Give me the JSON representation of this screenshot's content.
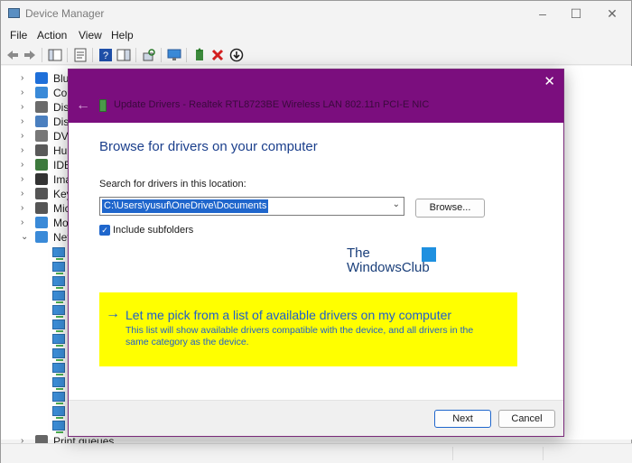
{
  "window": {
    "title": "Device Manager"
  },
  "menu": [
    "File",
    "Action",
    "View",
    "Help"
  ],
  "tree": {
    "items": [
      {
        "label": "Blue",
        "icon": "bluetooth-icon",
        "color": "#1e6fd9"
      },
      {
        "label": "Com",
        "icon": "computer-icon",
        "color": "#3a8ad8"
      },
      {
        "label": "Disk",
        "icon": "disk-drive-icon",
        "color": "#6b6b6b"
      },
      {
        "label": "Disp",
        "icon": "display-adapter-icon",
        "color": "#4a7fbf"
      },
      {
        "label": "DVD",
        "icon": "dvd-drive-icon",
        "color": "#777777"
      },
      {
        "label": "Hum",
        "icon": "hid-icon",
        "color": "#5a5a5a"
      },
      {
        "label": "IDE",
        "icon": "ide-controller-icon",
        "color": "#3d7a3d"
      },
      {
        "label": "Ima",
        "icon": "imaging-device-icon",
        "color": "#333333"
      },
      {
        "label": "Key",
        "icon": "keyboard-icon",
        "color": "#555555"
      },
      {
        "label": "Mic",
        "icon": "mouse-icon",
        "color": "#555555"
      },
      {
        "label": "Mo",
        "icon": "monitor-icon",
        "color": "#3a8ad8"
      },
      {
        "label": "Net",
        "icon": "network-adapter-icon",
        "color": "#3a8ad8"
      }
    ],
    "bottom_label": "Print queues"
  },
  "dialog": {
    "title": "Update Drivers - Realtek RTL8723BE Wireless LAN 802.11n PCI-E NIC",
    "heading": "Browse for drivers on your computer",
    "search_label": "Search for drivers in this location:",
    "path_value": "C:\\Users\\yusuf\\OneDrive\\Documents",
    "browse_label": "Browse...",
    "include_subfolders_label": "Include subfolders",
    "include_subfolders_checked": true,
    "watermark_line1": "The",
    "watermark_line2": "WindowsClub",
    "pick_title": "Let me pick from a list of available drivers on my computer",
    "pick_description": "This list will show available drivers compatible with the device, and all drivers in the same category as the device.",
    "next_label": "Next",
    "cancel_label": "Cancel"
  },
  "colors": {
    "dialog_header": "#7b0e7e",
    "heading": "#1b3f8c",
    "highlight": "#ffff00",
    "link": "#1f5fcc",
    "selection": "#1f66cc"
  }
}
